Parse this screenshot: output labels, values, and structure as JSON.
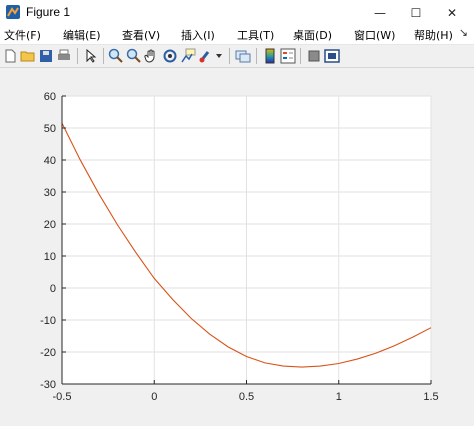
{
  "window": {
    "title": "Figure 1",
    "minimize_glyph": "—",
    "maximize_glyph": "☐",
    "close_glyph": "✕"
  },
  "menu": {
    "items": [
      {
        "label": "文件(F)"
      },
      {
        "label": "编辑(E)"
      },
      {
        "label": "查看(V)"
      },
      {
        "label": "插入(I)"
      },
      {
        "label": "工具(T)"
      },
      {
        "label": "桌面(D)"
      },
      {
        "label": "窗口(W)"
      },
      {
        "label": "帮助(H)"
      }
    ],
    "dock_glyph": "↘"
  },
  "toolbar": {
    "icons": [
      "new-figure-icon",
      "open-file-icon",
      "save-icon",
      "print-icon",
      "edit-plot-icon",
      "zoom-in-icon",
      "zoom-out-icon",
      "pan-icon",
      "rotate-3d-icon",
      "data-cursor-icon",
      "brush-icon",
      "brush-dropdown-icon",
      "link-plot-icon",
      "colorbar-icon",
      "legend-icon",
      "hide-plot-tools-icon",
      "show-plot-tools-icon"
    ]
  },
  "chart_data": {
    "type": "line",
    "title": "",
    "xlabel": "",
    "ylabel": "",
    "xlim": [
      -0.5,
      1.5
    ],
    "ylim": [
      -30,
      60
    ],
    "xticks": [
      "-0.5",
      "0",
      "0.5",
      "1",
      "1.5"
    ],
    "yticks": [
      "-30",
      "-20",
      "-10",
      "0",
      "10",
      "20",
      "30",
      "40",
      "50",
      "60"
    ],
    "grid": true,
    "series": [
      {
        "color": "#d95319",
        "x": [
          -0.5,
          -0.4,
          -0.3,
          -0.2,
          -0.1,
          0.0,
          0.1,
          0.2,
          0.3,
          0.4,
          0.5,
          0.6,
          0.7,
          0.8,
          0.9,
          1.0,
          1.1,
          1.2,
          1.3,
          1.4,
          1.5
        ],
        "y": [
          51.5,
          39.9,
          29.4,
          19.8,
          11.1,
          3.0,
          -3.6,
          -9.5,
          -14.4,
          -18.4,
          -21.4,
          -23.4,
          -24.4,
          -24.7,
          -24.4,
          -23.6,
          -22.2,
          -20.4,
          -18.1,
          -15.4,
          -12.4
        ]
      }
    ]
  }
}
